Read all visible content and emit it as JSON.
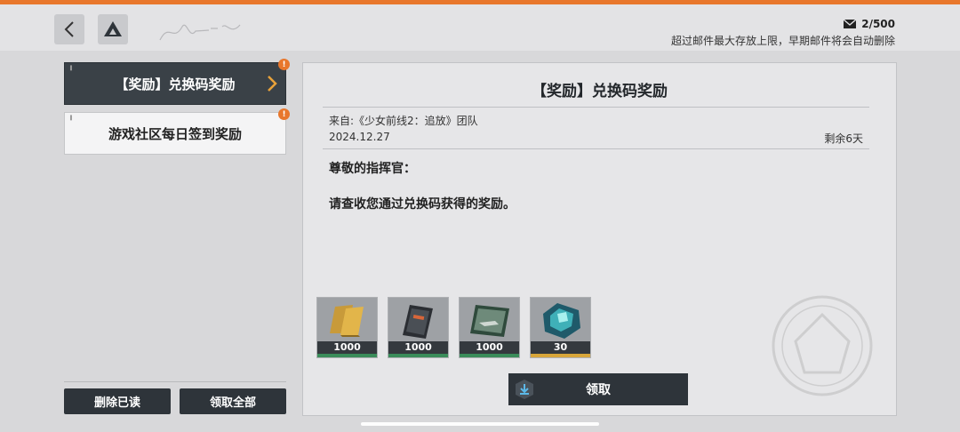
{
  "header": {
    "mail_count": "2/500",
    "mail_note": "超过邮件最大存放上限，早期邮件将会自动删除"
  },
  "mail_list": [
    {
      "label": "【奖励】兑换码奖励",
      "active": true
    },
    {
      "label": "游戏社区每日签到奖励",
      "active": false
    }
  ],
  "left_buttons": {
    "delete_read": "删除已读",
    "claim_all": "领取全部"
  },
  "mail": {
    "title": "【奖励】兑换码奖励",
    "from": "来自:《少女前线2：追放》团队",
    "date": "2024.12.27",
    "remaining": "剩余6天",
    "greeting": "尊敬的指挥官：",
    "body": "请查收您通过兑换码获得的奖励。"
  },
  "rewards": [
    {
      "icon": "gold-bars-icon",
      "qty": "1000"
    },
    {
      "icon": "ticket-icon",
      "qty": "1000"
    },
    {
      "icon": "weapon-card-icon",
      "qty": "1000"
    },
    {
      "icon": "crystal-icon",
      "qty": "30"
    }
  ],
  "claim_button": "领取",
  "colors": {
    "accent": "#e8772c",
    "dark_button": "#2e343a",
    "rarity_green": "#3a8c5a",
    "rarity_gold": "#d8a63a"
  }
}
